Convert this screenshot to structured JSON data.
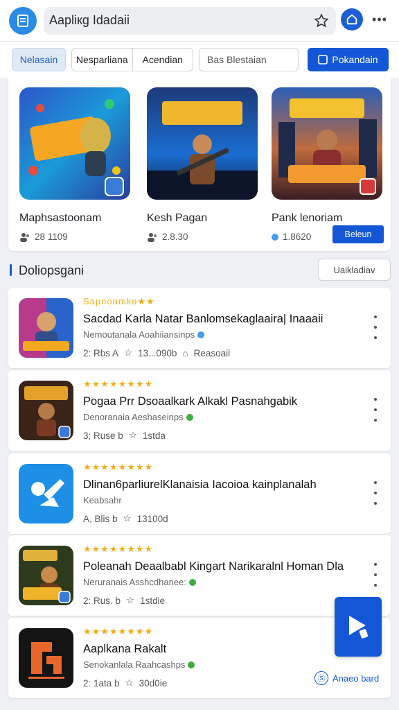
{
  "topbar": {
    "title": "Aapliкg Idadaii",
    "menu_icon": "document-icon",
    "star_icon": "star-icon",
    "home_icon": "home-icon",
    "more_label": "•••"
  },
  "filters": {
    "chip_active": "Nelasain",
    "segment": [
      "Nesparliana",
      "Acendian"
    ],
    "search_placeholder": "Bas Blestaian",
    "primary_button": "Pokandain"
  },
  "featured": [
    {
      "name": "Maphsastoonam",
      "meta": "28 1109"
    },
    {
      "name": "Kesh Pagan",
      "meta": "2.8.30"
    },
    {
      "name": "Pank lenoriam",
      "meta": "1.8620",
      "button": "Beleun"
    }
  ],
  "section": {
    "title": "Doliopsgani",
    "button": "Uaikladiav"
  },
  "apps": [
    {
      "stars": "Sapnonmko★★",
      "title": "Sacdad Karla Natar Banlomsekaglaaira| Inaaaii",
      "sub": "Nemoutanala Aoahiiansinps",
      "meta_a": "2: Rbs A",
      "meta_b": "13...090b",
      "meta_c": "Reasoail"
    },
    {
      "stars": "★★★★★★★★",
      "title": "Pogaa Prr Dsoaalkark Alkakl Pasnahgabik",
      "sub": "Denoranaia Aeshaseinps",
      "meta_a": "3; Ruse b",
      "meta_b": "1stda"
    },
    {
      "stars": "★★★★★★★★",
      "title": "Dlinan6parliurelKlanaisia Iacoioa kainplanalah",
      "sub": "Keabsahr",
      "meta_a": "A, Blis b",
      "meta_b": "13100d"
    },
    {
      "stars": "★★★★★★★★",
      "title": "Poleanah Deaalbabl Kingart Narikaralnl Homan Dla",
      "sub": "Neruranais Asshcdhanee:",
      "meta_a": "2: Rus. b",
      "meta_b": "1stdie"
    },
    {
      "stars": "★★★★★★★★",
      "title": "Aaplkana Rakalt",
      "sub": "Senokanlala Raahcashps",
      "meta_a": "2: 1ata b",
      "meta_b": "30d0ie"
    }
  ],
  "footer_link": "Anaeo bard",
  "colors": {
    "accent": "#1357d6",
    "star": "#f2ad16",
    "menu": "#2a8ce6"
  }
}
